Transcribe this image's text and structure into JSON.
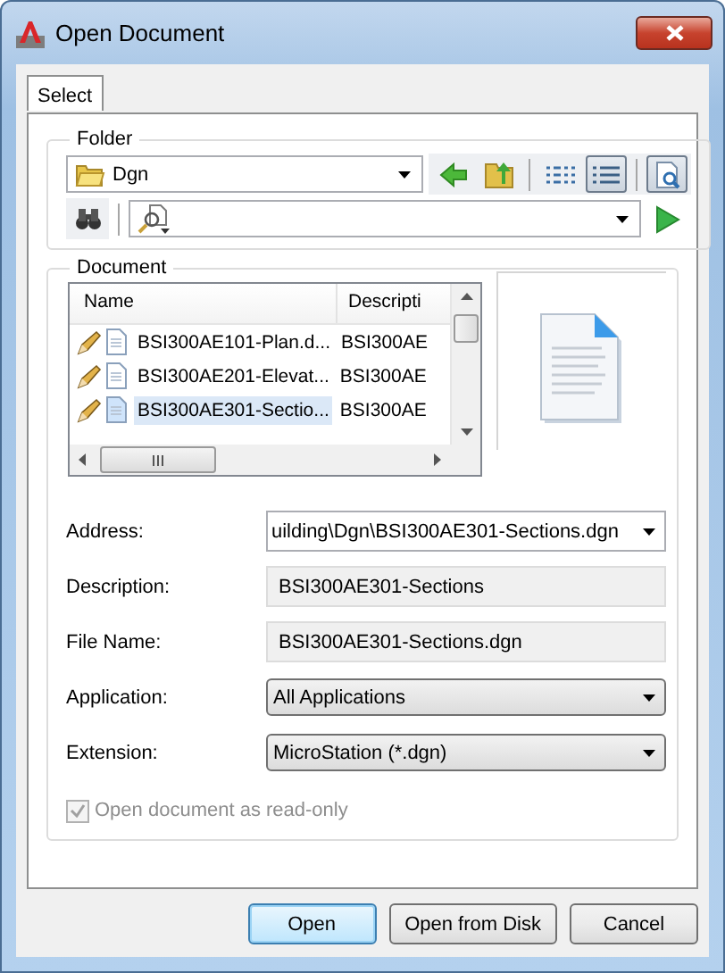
{
  "window": {
    "title": "Open Document"
  },
  "tabs": [
    {
      "label": "Select",
      "selected": true
    }
  ],
  "folder": {
    "label": "Folder",
    "path": "Dgn",
    "views": [
      {
        "kind": "list",
        "selected": false
      },
      {
        "kind": "details",
        "selected": true
      },
      {
        "kind": "preview",
        "selected": true
      }
    ]
  },
  "document": {
    "label": "Document",
    "columns": [
      "Name",
      "Descripti"
    ],
    "rows": [
      {
        "name": "BSI300AE101-Plan.d...",
        "description": "BSI300AE",
        "selected": false
      },
      {
        "name": "BSI300AE201-Elevat...",
        "description": "BSI300AE",
        "selected": false
      },
      {
        "name": "BSI300AE301-Sectio...",
        "description": "BSI300AE",
        "selected": true
      }
    ],
    "fields": [
      {
        "kind": "edit-dropdown",
        "label": "Address:",
        "value": "uilding\\Dgn\\BSI300AE301-Sections.dgn"
      },
      {
        "kind": "readonly",
        "label": "Description:",
        "value": "BSI300AE301-Sections"
      },
      {
        "kind": "readonly",
        "label": "File Name:",
        "value": "BSI300AE301-Sections.dgn"
      },
      {
        "kind": "dropdown",
        "label": "Application:",
        "value": "All Applications"
      },
      {
        "kind": "dropdown",
        "label": "Extension:",
        "value": "MicroStation (*.dgn)"
      }
    ],
    "read_only": {
      "label": "Open document as read-only",
      "checked": true,
      "disabled": true
    }
  },
  "buttons": [
    {
      "label": "Open",
      "default": true
    },
    {
      "label": "Open from Disk",
      "default": false
    },
    {
      "label": "Cancel",
      "default": false
    }
  ]
}
